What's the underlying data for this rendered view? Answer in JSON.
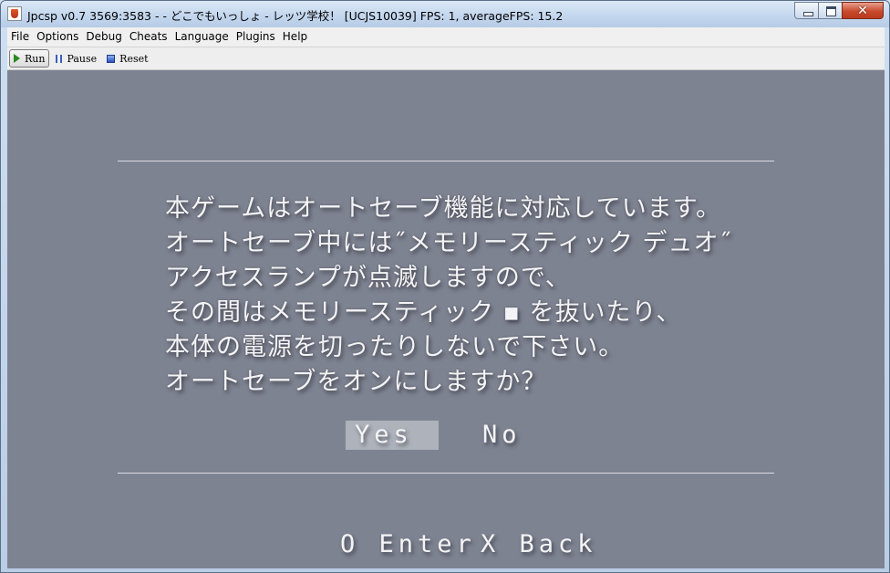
{
  "window": {
    "title": "Jpcsp v0.7 3569:3583 - - どこでもいっしょ - レッツ学校！ [UCJS10039] FPS: 1, averageFPS: 15.2",
    "close_glyph": "✕"
  },
  "menubar": {
    "items": [
      "File",
      "Options",
      "Debug",
      "Cheats",
      "Language",
      "Plugins",
      "Help"
    ]
  },
  "toolbar": {
    "run": "Run",
    "pause": "Pause",
    "reset": "Reset"
  },
  "game": {
    "dialog_lines": [
      "本ゲームはオートセーブ機能に対応しています。",
      "オートセーブ中には˝メモリースティック デュオ˝",
      "アクセスランプが点滅しますので、",
      "その間はメモリースティック ▪ を抜いたり、",
      "本体の電源を切ったりしないで下さい。",
      "オートセーブをオンにしますか？"
    ],
    "choices": {
      "yes": "Yes",
      "no": "No",
      "selected": "Yes"
    },
    "hints": {
      "enter": "O Enter",
      "back": "X Back"
    }
  },
  "colors": {
    "game_background": "#7e8391",
    "text": "#f4f4f6",
    "selection": "#bec1ca"
  }
}
